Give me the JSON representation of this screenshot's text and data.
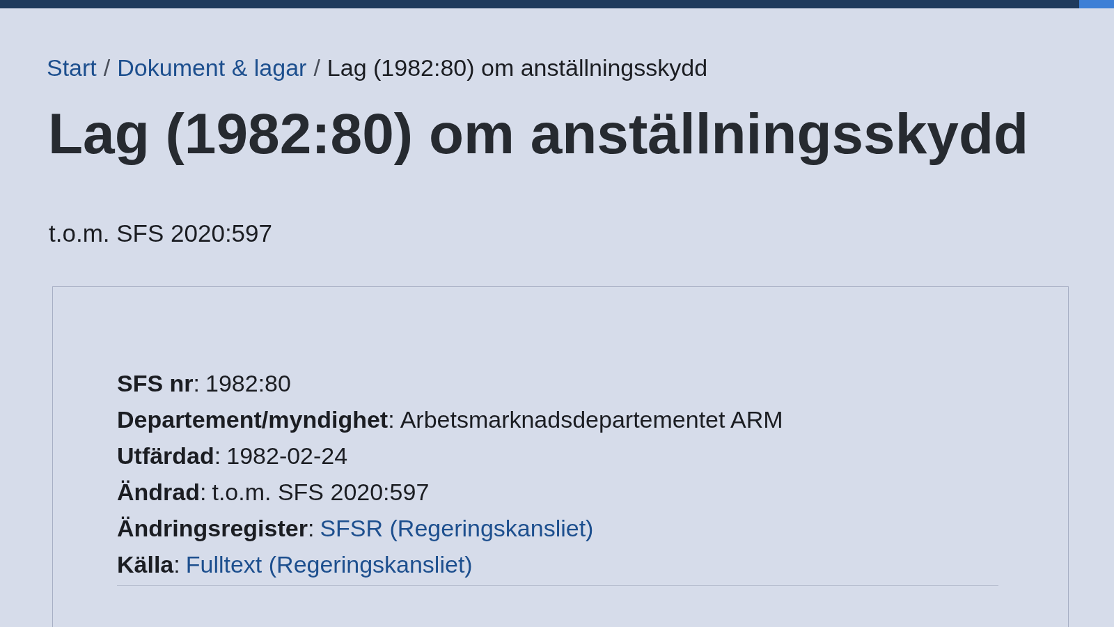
{
  "breadcrumb": [
    {
      "kind": "link",
      "label": "Start"
    },
    {
      "kind": "separator",
      "label": "/"
    },
    {
      "kind": "link",
      "label": "Dokument & lagar"
    },
    {
      "kind": "separator",
      "label": "/"
    },
    {
      "kind": "current",
      "label": "Lag (1982:80) om anställningsskydd"
    }
  ],
  "title": "Lag (1982:80) om anställningsskydd",
  "subtitle": "t.o.m. SFS 2020:597",
  "details": [
    {
      "kind": "text",
      "label": "**SFS nr**:",
      "value": "1982:80"
    },
    {
      "kind": "text",
      "label": "**Departement/myndighet**:",
      "value": "Arbetsmarknadsdepartementet ARM"
    },
    {
      "kind": "text",
      "label": "**Utfärdad**:",
      "value": "1982-02-24"
    },
    {
      "kind": "text",
      "label": "**Ändrad**:",
      "value": "t.o.m. SFS 2020:597"
    },
    {
      "kind": "link",
      "label": "**Ändringsregister**:",
      "value": "SFSR (Regeringskansliet)"
    },
    {
      "kind": "link",
      "label": "**Källa**:",
      "value": "Fulltext (Regeringskansliet)"
    }
  ]
}
